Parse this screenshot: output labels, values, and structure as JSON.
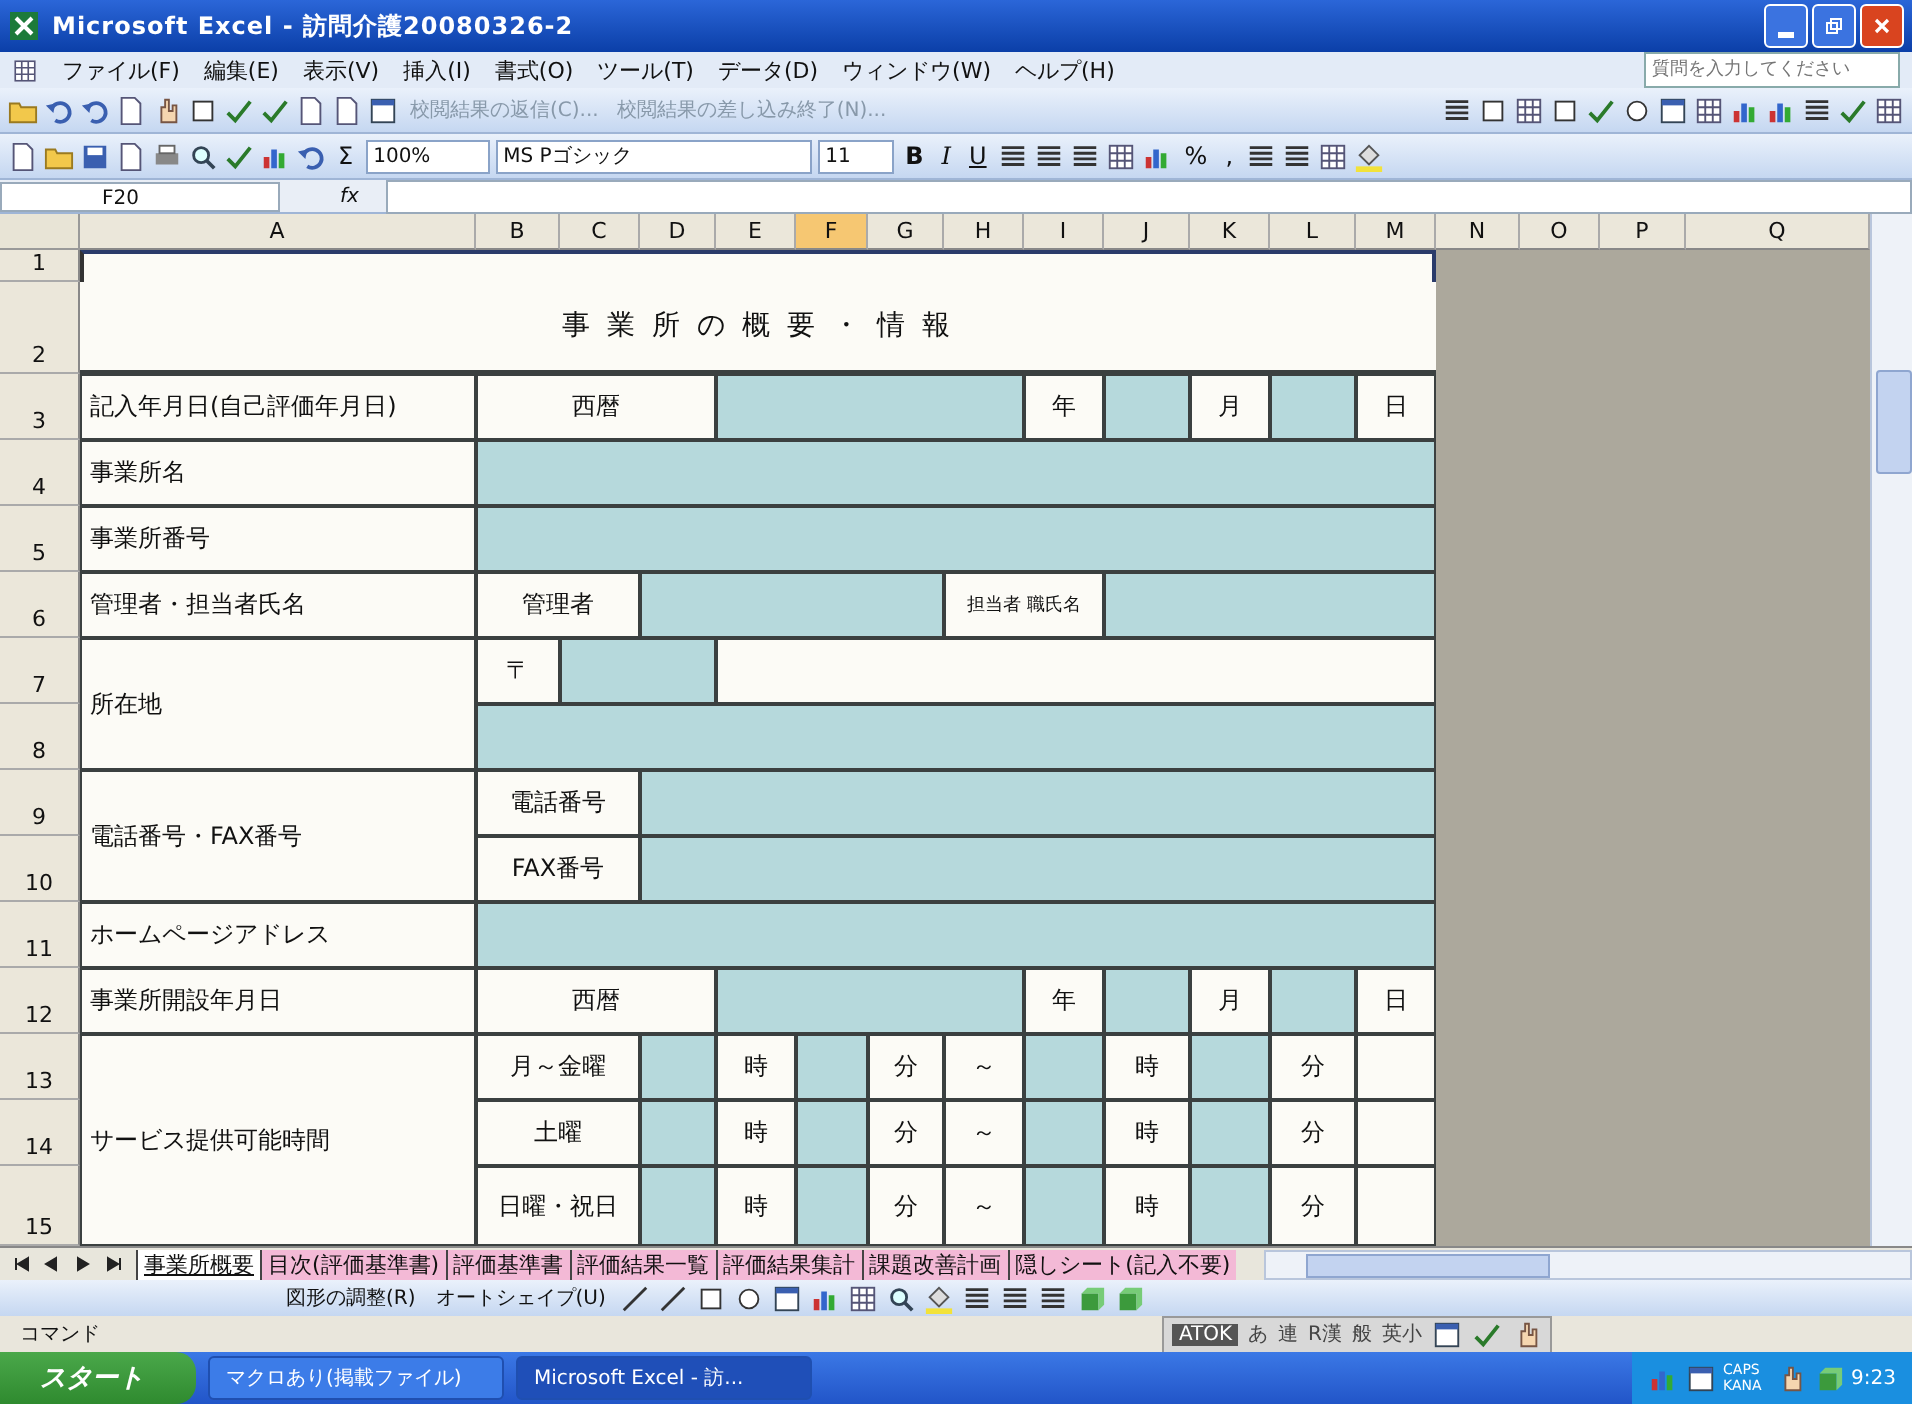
{
  "window": {
    "title": "Microsoft Excel - 訪問介護20080326-2"
  },
  "menu": [
    "ファイル(F)",
    "編集(E)",
    "表示(V)",
    "挿入(I)",
    "書式(O)",
    "ツール(T)",
    "データ(D)",
    "ウィンドウ(W)",
    "ヘルプ(H)"
  ],
  "help_box": {
    "placeholder": "質問を入力してください"
  },
  "review_toolbar": {
    "items": [
      "校閲結果の返信(C)...",
      "校閲結果の差し込み終了(N)..."
    ]
  },
  "format_toolbar": {
    "zoom": "100%",
    "font": "MS Pゴシック",
    "size": "11",
    "sum": "Σ",
    "bold": "B",
    "italic": "I",
    "underline": "U",
    "percent": "%",
    "comma": ","
  },
  "formula_bar": {
    "name_box": "F20",
    "fx": "fx"
  },
  "sheet": {
    "columns": [
      {
        "label": "A",
        "selected": false
      },
      {
        "label": "B",
        "selected": false
      },
      {
        "label": "C",
        "selected": false
      },
      {
        "label": "D",
        "selected": false
      },
      {
        "label": "E",
        "selected": false
      },
      {
        "label": "F",
        "selected": true
      },
      {
        "label": "G",
        "selected": false
      },
      {
        "label": "H",
        "selected": false
      },
      {
        "label": "I",
        "selected": false
      },
      {
        "label": "J",
        "selected": false
      },
      {
        "label": "K",
        "selected": false
      },
      {
        "label": "L",
        "selected": false
      },
      {
        "label": "M",
        "selected": false
      },
      {
        "label": "N",
        "selected": false
      },
      {
        "label": "O",
        "selected": false
      },
      {
        "label": "P",
        "selected": false
      },
      {
        "label": "Q",
        "selected": false
      }
    ],
    "rows": [
      {
        "number": "1",
        "kind": "blank"
      },
      {
        "number": "2",
        "kind": "title",
        "texts": [
          "事 業 所 の 概 要 ・ 情 報"
        ]
      },
      {
        "number": "3",
        "kind": "date",
        "texts": [
          "記入年月日(自己評価年月日)",
          "西暦",
          "年",
          "月",
          "日"
        ]
      },
      {
        "number": "4",
        "kind": "wide",
        "texts": [
          "事業所名"
        ]
      },
      {
        "number": "5",
        "kind": "wide",
        "texts": [
          "事業所番号"
        ]
      },
      {
        "number": "6",
        "kind": "manager",
        "texts": [
          "管理者・担当者氏名",
          "管理者",
          "担当者 職氏名"
        ]
      },
      {
        "number": "7",
        "kind": "address",
        "texts": [
          "所在地",
          "〒"
        ]
      },
      {
        "number": "8",
        "kind": "address_line"
      },
      {
        "number": "9",
        "kind": "phone",
        "texts": [
          "電話番号・FAX番号",
          "電話番号"
        ]
      },
      {
        "number": "10",
        "kind": "fax",
        "texts": [
          "FAX番号"
        ]
      },
      {
        "number": "11",
        "kind": "wide",
        "texts": [
          "ホームページアドレス"
        ]
      },
      {
        "number": "12",
        "kind": "date",
        "texts": [
          "事業所開設年月日",
          "西暦",
          "年",
          "月",
          "日"
        ]
      },
      {
        "number": "13",
        "kind": "hours_first",
        "texts": [
          "サービス提供可能時間",
          "月～金曜",
          "時",
          "分",
          "～",
          "時",
          "分"
        ]
      },
      {
        "number": "14",
        "kind": "hours",
        "texts": [
          "土曜",
          "時",
          "分",
          "～",
          "時",
          "分"
        ]
      },
      {
        "number": "15",
        "kind": "hours",
        "texts": [
          "日曜・祝日",
          "時",
          "分",
          "～",
          "時",
          "分"
        ]
      }
    ]
  },
  "sheet_tabs": [
    {
      "label": "事業所概要",
      "selected": true
    },
    {
      "label": "目次(評価基準書)",
      "selected": false
    },
    {
      "label": "評価基準書",
      "selected": false
    },
    {
      "label": "評価結果一覧",
      "selected": false
    },
    {
      "label": "評価結果集計",
      "selected": false
    },
    {
      "label": "課題改善計画",
      "selected": false
    },
    {
      "label": "隠しシート(記入不要)",
      "selected": false
    }
  ],
  "drawing_toolbar": {
    "items": [
      "図形の調整(R)",
      "オートシェイプ(U)"
    ]
  },
  "status_bar": {
    "text": "コマンド"
  },
  "ime_bar": {
    "items": [
      "ATOK",
      "あ",
      "連",
      "R漢",
      "般",
      "英小"
    ]
  },
  "taskbar": {
    "start": "スタート",
    "tasks": [
      {
        "label": "マクロあり(掲載ファイル)",
        "selected": false
      },
      {
        "label": "Microsoft Excel - 訪...",
        "selected": true
      }
    ],
    "tray": "CAPS KANA",
    "clock": "9:23"
  }
}
